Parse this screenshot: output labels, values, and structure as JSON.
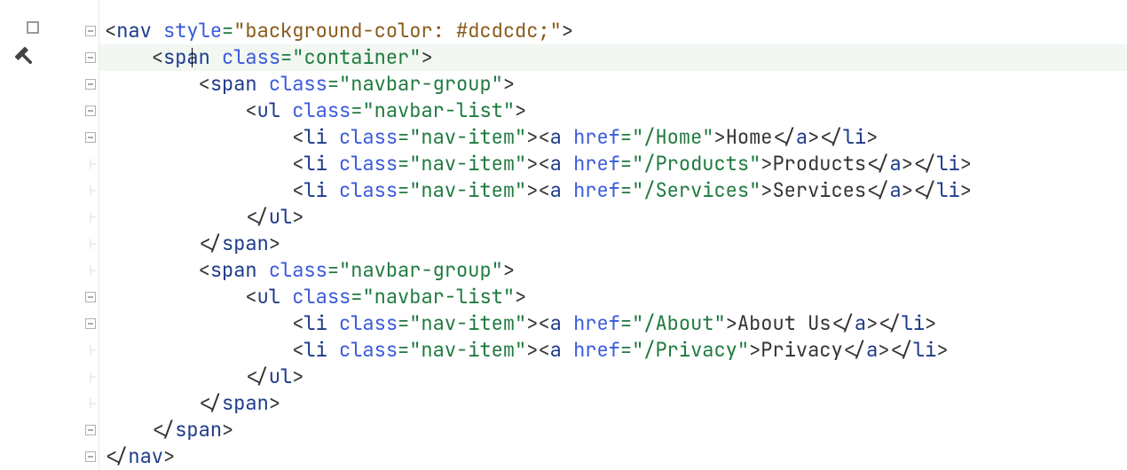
{
  "gutter": {
    "topOffset": 20,
    "lineHeight": 30,
    "foldsAt": [
      0,
      1,
      2,
      3,
      4,
      10,
      11,
      15,
      16
    ],
    "hasBreakpointBox": true,
    "hasHammer": true
  },
  "highlightLine": 1,
  "caret": {
    "line": 1,
    "col": 10
  },
  "selections": {
    "open": [
      [
        1,
        5
      ],
      [
        2,
        7
      ],
      [
        10,
        7
      ],
      [
        15,
        5
      ]
    ],
    "close": [
      [
        9,
        9
      ],
      [
        14,
        9
      ]
    ],
    "closePurple": [
      [
        16,
        7
      ]
    ]
  },
  "lines": [
    {
      "indent": 0,
      "kind": "open",
      "tag": "nav",
      "attr": "style",
      "val": "background-color: #dcdcdc;",
      "valClass": "t-style"
    },
    {
      "indent": 1,
      "kind": "open",
      "tag": "span",
      "attr": "class",
      "val": "container",
      "valClass": "t-str"
    },
    {
      "indent": 2,
      "kind": "open",
      "tag": "span",
      "attr": "class",
      "val": "navbar-group",
      "valClass": "t-str"
    },
    {
      "indent": 3,
      "kind": "open",
      "tag": "ul",
      "attr": "class",
      "val": "navbar-list",
      "valClass": "t-str"
    },
    {
      "indent": 4,
      "kind": "li",
      "href": "/Home",
      "text": "Home"
    },
    {
      "indent": 4,
      "kind": "li",
      "href": "/Products",
      "text": "Products"
    },
    {
      "indent": 4,
      "kind": "li",
      "href": "/Services",
      "text": "Services"
    },
    {
      "indent": 3,
      "kind": "close",
      "tag": "ul"
    },
    {
      "indent": 2,
      "kind": "close",
      "tag": "span"
    },
    {
      "indent": 2,
      "kind": "open",
      "tag": "span",
      "attr": "class",
      "val": "navbar-group",
      "valClass": "t-str"
    },
    {
      "indent": 3,
      "kind": "open",
      "tag": "ul",
      "attr": "class",
      "val": "navbar-list",
      "valClass": "t-str"
    },
    {
      "indent": 4,
      "kind": "li",
      "href": "/About",
      "text": "About Us"
    },
    {
      "indent": 4,
      "kind": "li",
      "href": "/Privacy",
      "text": "Privacy"
    },
    {
      "indent": 3,
      "kind": "close",
      "tag": "ul"
    },
    {
      "indent": 2,
      "kind": "close",
      "tag": "span"
    },
    {
      "indent": 1,
      "kind": "close",
      "tag": "span"
    },
    {
      "indent": 0,
      "kind": "close",
      "tag": "nav"
    }
  ]
}
